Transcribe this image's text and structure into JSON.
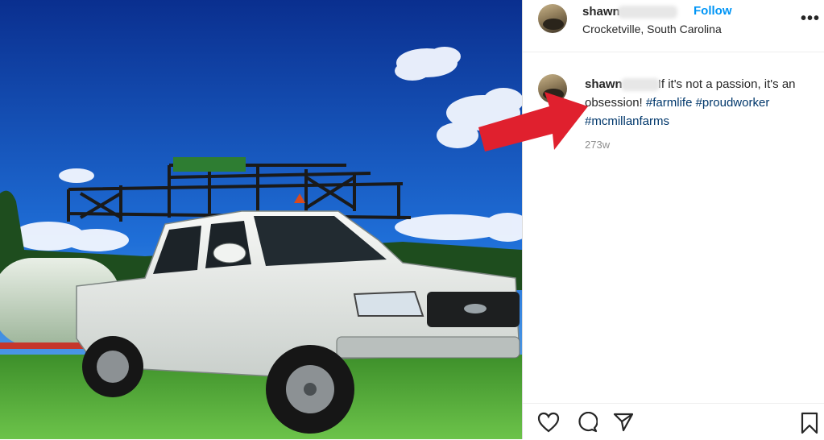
{
  "header": {
    "username": "shawn",
    "follow_label": "Follow",
    "location": "Crocketville, South Carolina",
    "more_label": "•••"
  },
  "caption": {
    "username": "shawn",
    "text": "If it's not a passion, it's an obsession! ",
    "hashtags": [
      "#farmlife",
      "#proudworker",
      "#mcmillanfarms"
    ],
    "time_ago": "273w"
  },
  "icons": [
    "heart-icon",
    "comment-icon",
    "share-icon",
    "bookmark-icon"
  ],
  "colors": {
    "link": "#0095f6",
    "hashtag": "#00376b",
    "annotation_arrow": "#e0202e"
  }
}
